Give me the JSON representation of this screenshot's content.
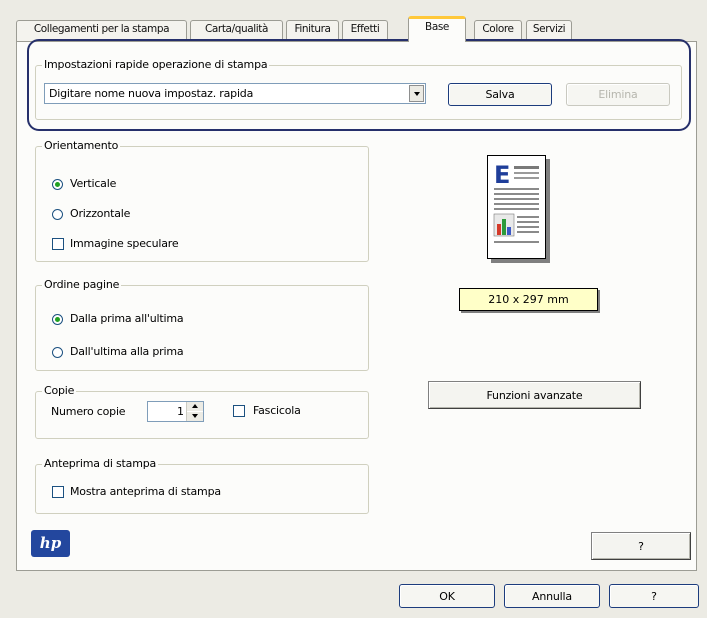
{
  "tabs": [
    {
      "label": "Collegamenti per la stampa",
      "active": false
    },
    {
      "label": "Carta/qualità",
      "active": false
    },
    {
      "label": "Finitura",
      "active": false
    },
    {
      "label": "Effetti",
      "active": false
    },
    {
      "label": "Base",
      "active": true
    },
    {
      "label": "Colore",
      "active": false
    },
    {
      "label": "Servizi",
      "active": false
    }
  ],
  "quick_sets": {
    "legend": "Impostazioni rapide operazione di stampa",
    "selected_value": "Digitare nome nuova impostaz. rapida",
    "save_label": "Salva",
    "delete_label": "Elimina"
  },
  "orientation": {
    "legend": "Orientamento",
    "portrait_label": "Verticale",
    "landscape_label": "Orizzontale",
    "mirror_label": "Immagine speculare",
    "selected": "Verticale",
    "mirror_checked": false
  },
  "page_order": {
    "legend": "Ordine pagine",
    "first_to_last_label": "Dalla prima all'ultima",
    "last_to_first_label": "Dall'ultima alla prima",
    "selected": "Dalla prima all'ultima"
  },
  "copies": {
    "legend": "Copie",
    "count_label": "Numero copie",
    "count_value": "1",
    "collate_label": "Fascicola",
    "collate_checked": false
  },
  "print_preview": {
    "legend": "Anteprima di stampa",
    "show_label": "Mostra anteprima di stampa",
    "checked": false
  },
  "preview": {
    "paper_size": "210 x 297 mm",
    "letter": "E"
  },
  "advanced_button_label": "Funzioni avanzate",
  "help_button_label": "?",
  "dialog": {
    "ok_label": "OK",
    "cancel_label": "Annulla",
    "help_label": "?"
  },
  "logo_text": "hp",
  "colors": {
    "highlight_ring": "#26306b",
    "active_tab_accent": "#ffc83a",
    "paper_size_bg": "#ffffc8",
    "hp_blue": "#23479e"
  }
}
